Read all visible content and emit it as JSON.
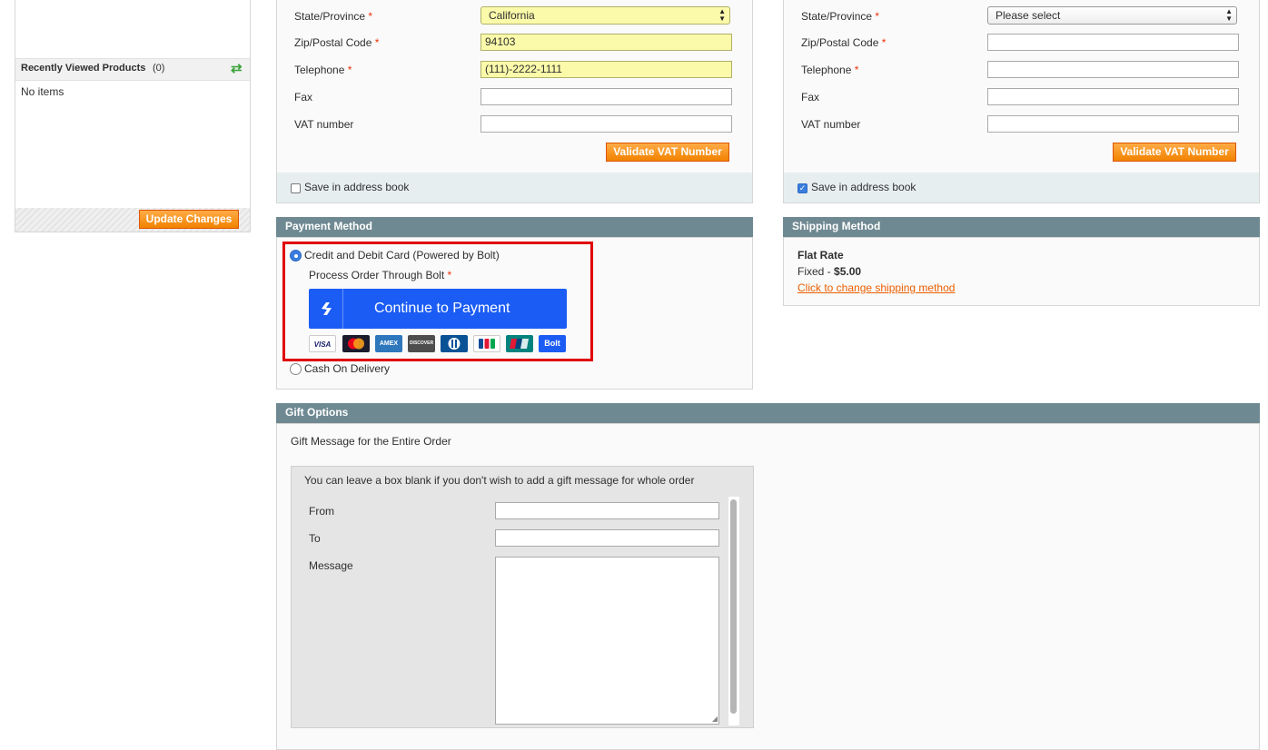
{
  "sidebar": {
    "recently_viewed_title": "Recently Viewed Products",
    "recently_viewed_count": "(0)",
    "no_items": "No items",
    "update_button": "Update Changes"
  },
  "billing_address": {
    "state_label": "State/Province",
    "state_value": "California",
    "zip_label": "Zip/Postal Code",
    "zip_value": "94103",
    "telephone_label": "Telephone",
    "telephone_value": "(111)-2222-1111",
    "fax_label": "Fax",
    "fax_value": "",
    "vat_label": "VAT number",
    "vat_value": "",
    "validate_vat_button": "Validate VAT Number",
    "save_in_address_book": "Save in address book",
    "save_checked": false
  },
  "shipping_address": {
    "state_label": "State/Province",
    "state_value": "Please select",
    "zip_label": "Zip/Postal Code",
    "zip_value": "",
    "telephone_label": "Telephone",
    "telephone_value": "",
    "fax_label": "Fax",
    "fax_value": "",
    "vat_label": "VAT number",
    "vat_value": "",
    "validate_vat_button": "Validate VAT Number",
    "save_in_address_book": "Save in address book",
    "save_checked": true
  },
  "required_marker": "*",
  "payment_method": {
    "title": "Payment Method",
    "option_bolt": "Credit and Debit Card (Powered by Bolt)",
    "process_label": "Process Order Through Bolt",
    "continue_button": "Continue to Payment",
    "cards": [
      "VISA",
      "Mastercard",
      "AMEX",
      "DISCOVER",
      "Diners",
      "JCB",
      "UnionPay",
      "Bolt"
    ],
    "option_cod": "Cash On Delivery",
    "highlight_color": "#e00000",
    "bolt_button_color": "#1b5cf5"
  },
  "shipping_method": {
    "title": "Shipping Method",
    "rate_name": "Flat Rate",
    "rate_prefix": "Fixed - ",
    "rate_price": "$5.00",
    "change_link": "Click to change shipping method"
  },
  "gift_options": {
    "title": "Gift Options",
    "subtitle": "Gift Message for the Entire Order",
    "note": "You can leave a box blank if you don't wish to add a gift message for whole order",
    "from_label": "From",
    "to_label": "To",
    "message_label": "Message",
    "from_value": "",
    "to_value": "",
    "message_value": ""
  },
  "colors": {
    "section_header": "#6f8992",
    "accent_orange": "#f18200",
    "link_orange": "#eb5e00"
  }
}
